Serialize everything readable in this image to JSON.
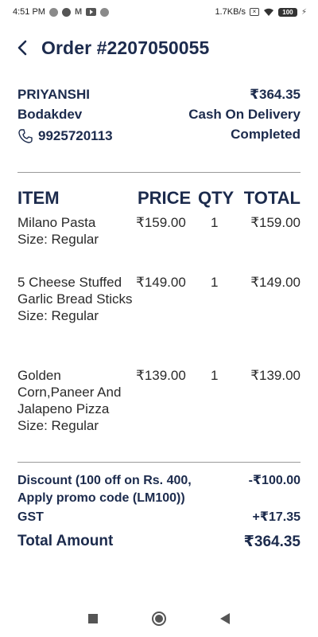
{
  "status_bar": {
    "time": "4:51 PM",
    "speed": "1.7KB/s",
    "battery": "100"
  },
  "header": {
    "title": "Order #2207050055"
  },
  "customer": {
    "name": "PRIYANSHI",
    "area": "Bodakdev",
    "phone": "9925720113",
    "amount": "₹364.35",
    "payment": "Cash On Delivery",
    "status": "Completed"
  },
  "table": {
    "headers": {
      "item": "ITEM",
      "price": "PRICE",
      "qty": "QTY",
      "total": "TOTAL"
    },
    "items": [
      {
        "name": "Milano Pasta",
        "size": "Size: Regular",
        "price": "₹159.00",
        "qty": "1",
        "total": "₹159.00"
      },
      {
        "name": "5 Cheese Stuffed Garlic Bread Sticks",
        "size": "Size: Regular",
        "price": "₹149.00",
        "qty": "1",
        "total": "₹149.00"
      },
      {
        "name": "Golden Corn,Paneer And Jalapeno Pizza",
        "size": "Size: Regular",
        "price": "₹139.00",
        "qty": "1",
        "total": "₹139.00"
      }
    ]
  },
  "summary": {
    "discount_label": "Discount (100 off on Rs. 400, Apply promo code (LM100))",
    "discount_value": "-₹100.00",
    "gst_label": "GST",
    "gst_value": "+₹17.35",
    "total_label": "Total Amount",
    "total_value": "₹364.35"
  },
  "colors": {
    "primary": "#1c2b4d",
    "text": "#2a2a2a",
    "divider": "#9a9a9a"
  }
}
